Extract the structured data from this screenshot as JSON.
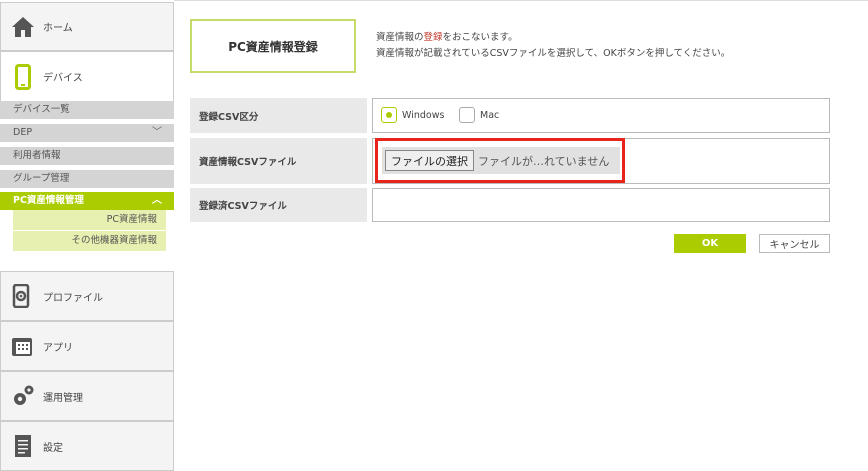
{
  "sidebar": {
    "home": {
      "label": "ホーム",
      "icon": "home-icon"
    },
    "device": {
      "label": "デバイス",
      "icon": "smartphone-icon"
    },
    "device_sub": [
      {
        "label": "デバイス一覧"
      },
      {
        "label": "DEP"
      },
      {
        "label": "利用者情報"
      },
      {
        "label": "グループ管理"
      },
      {
        "label": "PC資産情報管理"
      }
    ],
    "pc_asset_sub": [
      {
        "label": "PC資産情報"
      },
      {
        "label": "その他機器資産情報"
      }
    ],
    "profile": {
      "label": "プロファイル",
      "icon": "profile-gear-icon"
    },
    "app": {
      "label": "アプリ",
      "icon": "app-icon"
    },
    "ops": {
      "label": "運用管理",
      "icon": "gears-icon"
    },
    "settings": {
      "label": "設定",
      "icon": "document-icon"
    }
  },
  "main": {
    "title": "PC資産情報登録",
    "desc_line1_pre": "資産情報の",
    "desc_line1_em": "登録",
    "desc_line1_post": "をおこないます。",
    "desc_line2": "資産情報が記載されているCSVファイルを選択して、OKボタンを押してください。",
    "form": {
      "csv_type_label": "登録CSV区分",
      "options": [
        "Windows",
        "Mac"
      ],
      "selected": "Windows",
      "csv_file_label": "資産情報CSVファイル",
      "file_button": "ファイルの選択",
      "file_status": "ファイルが…れていません",
      "registered_label": "登録済CSVファイル",
      "registered_value": ""
    },
    "ok_label": "OK",
    "cancel_label": "キャンセル"
  },
  "colors": {
    "accent": "#aacc00",
    "highlight": "#e8251b",
    "title_border": "#c5dc6a"
  }
}
